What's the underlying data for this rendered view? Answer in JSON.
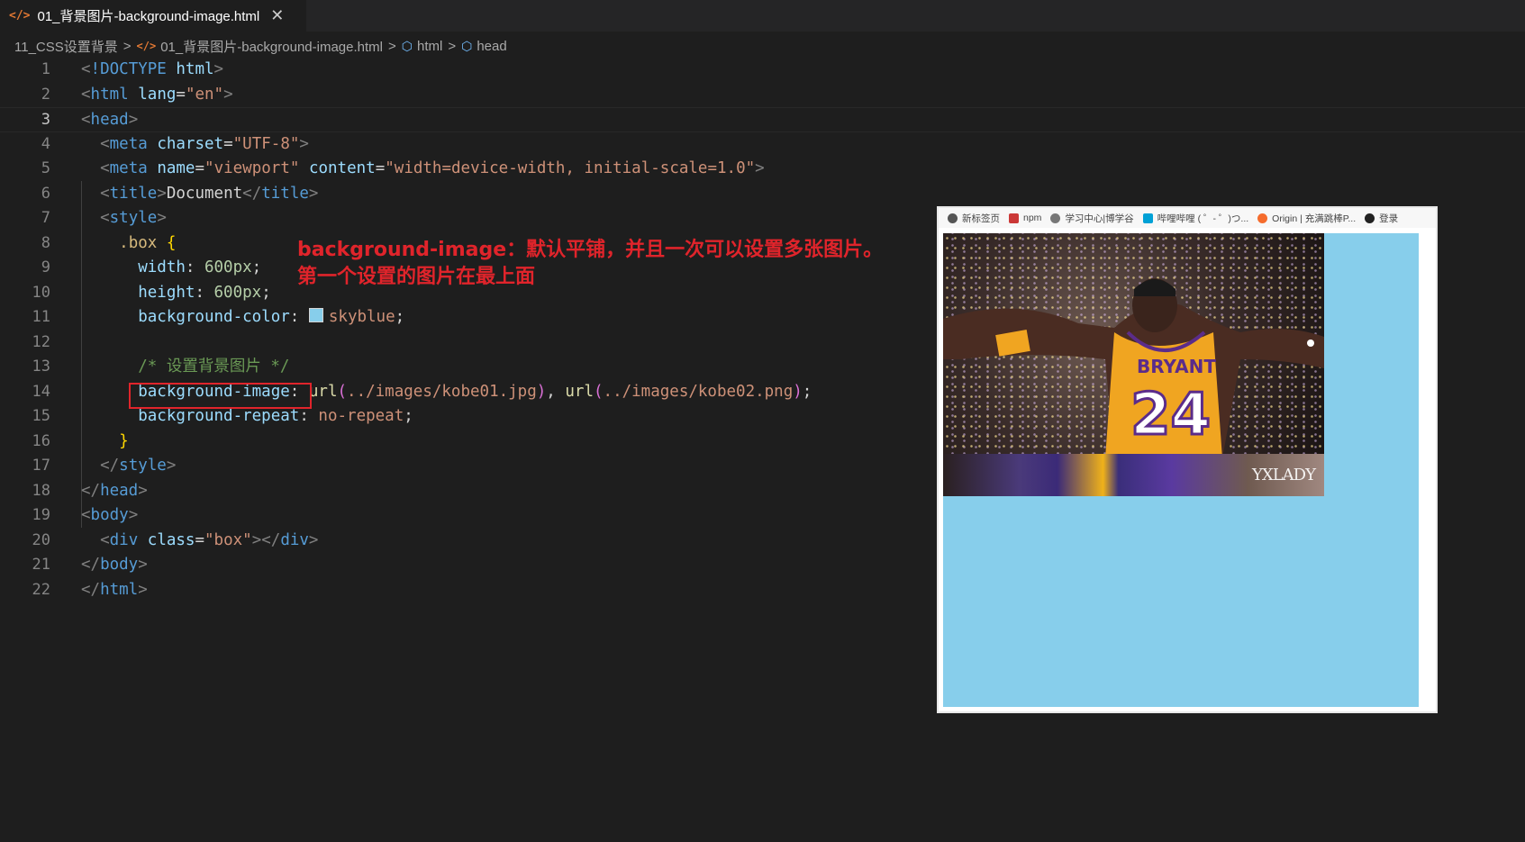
{
  "tab": {
    "filename": "01_背景图片-background-image.html",
    "close": "✕",
    "file_icon": "</>"
  },
  "breadcrumb": {
    "folder": "11_CSS设置背景",
    "file": "01_背景图片-background-image.html",
    "node1": "html",
    "node2": "head",
    "sep": ">"
  },
  "lines": [
    "1",
    "2",
    "3",
    "4",
    "5",
    "6",
    "7",
    "8",
    "9",
    "10",
    "11",
    "12",
    "13",
    "14",
    "15",
    "16",
    "17",
    "18",
    "19",
    "20",
    "21",
    "22"
  ],
  "active_line": "3",
  "code": {
    "doctype": "!DOCTYPE",
    "html_kw": "html",
    "html": "html",
    "lang": "lang",
    "lang_val": "\"en\"",
    "head": "head",
    "meta": "meta",
    "charset": "charset",
    "charset_val": "\"UTF-8\"",
    "name": "name",
    "name_val": "\"viewport\"",
    "content": "content",
    "content_val": "\"width=device-width, initial-scale=1.0\"",
    "title": "title",
    "title_text": "Document",
    "style": "style",
    "selector": ".box",
    "width_p": "width",
    "width_v": "600px",
    "height_p": "height",
    "height_v": "600px",
    "bgc_p": "background-color",
    "bgc_v": "skyblue",
    "comment": "/* 设置背景图片 */",
    "bgi_p": "background-image",
    "url": "url",
    "img1": "../images/kobe01.jpg",
    "img2": "../images/kobe02.png",
    "bgr_p": "background-repeat",
    "bgr_v": "no-repeat",
    "body": "body",
    "div": "div",
    "class": "class",
    "class_val": "\"box\""
  },
  "swatch_color": "#87ceeb",
  "annotation": {
    "line1": "background-image：默认平铺，并且一次可以设置多张图片。",
    "line2": "第一个设置的图片在最上面"
  },
  "preview": {
    "bookmarks": [
      {
        "label": "新标签页",
        "icon": "globe-icon",
        "color": "#555555"
      },
      {
        "label": "npm",
        "icon": "npm-icon",
        "color": "#cb3837"
      },
      {
        "label": "学习中心|博学谷",
        "icon": "globe-icon",
        "color": "#777777"
      },
      {
        "label": "哔哩哔哩 ( ゜- ゜)つ...",
        "icon": "bilibili-icon",
        "color": "#00a1d6"
      },
      {
        "label": "Origin | 充满跳棒P...",
        "icon": "origin-icon",
        "color": "#f56c2d"
      },
      {
        "label": "登录",
        "icon": "login-icon",
        "color": "#222222"
      }
    ],
    "box_color": "#87ceeb",
    "jersey_text": "BRYANT",
    "jersey_number": "24",
    "watermark": "YXLADY"
  }
}
